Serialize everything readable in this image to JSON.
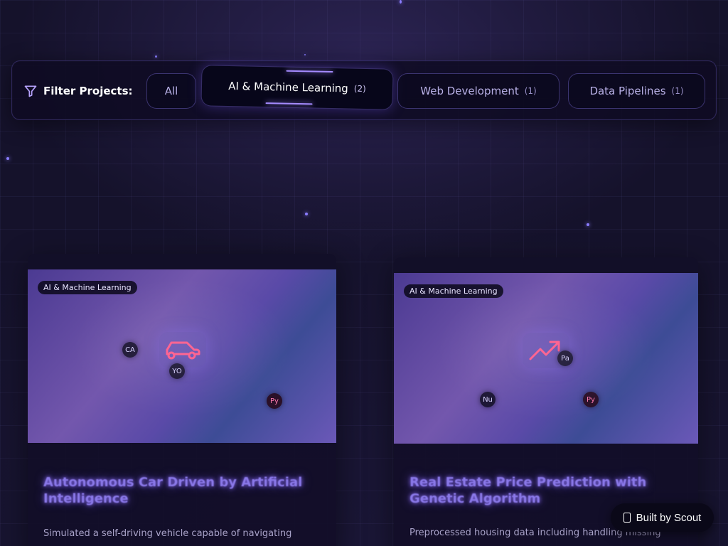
{
  "filter": {
    "label": "Filter Projects:",
    "icon": "filter-icon",
    "options": [
      {
        "label": "All",
        "count": ""
      },
      {
        "label": "AI & Machine Learning",
        "count": "(2)",
        "active": true
      },
      {
        "label": "Web Development",
        "count": "(1)"
      },
      {
        "label": "Data Pipelines",
        "count": "(1)"
      }
    ]
  },
  "projects": [
    {
      "category": "AI & Machine Learning",
      "icon": "car-icon",
      "tech": [
        "CA",
        "YO",
        "Py"
      ],
      "title": "Autonomous Car Driven by Artificial Intelligence",
      "description": "Simulated a self-driving vehicle capable of navigating"
    },
    {
      "category": "AI & Machine Learning",
      "icon": "trending-up-icon",
      "tech": [
        "Pa",
        "Nu",
        "Py"
      ],
      "title": "Real Estate Price Prediction with Genetic Algorithm",
      "description": "Preprocessed housing data including handling missing"
    }
  ],
  "built_by": {
    "label": "Built by Scout",
    "icon": "scout-icon"
  },
  "colors": {
    "accent": "#a58bff",
    "background": "#17132e",
    "badge": "#0a0818"
  }
}
